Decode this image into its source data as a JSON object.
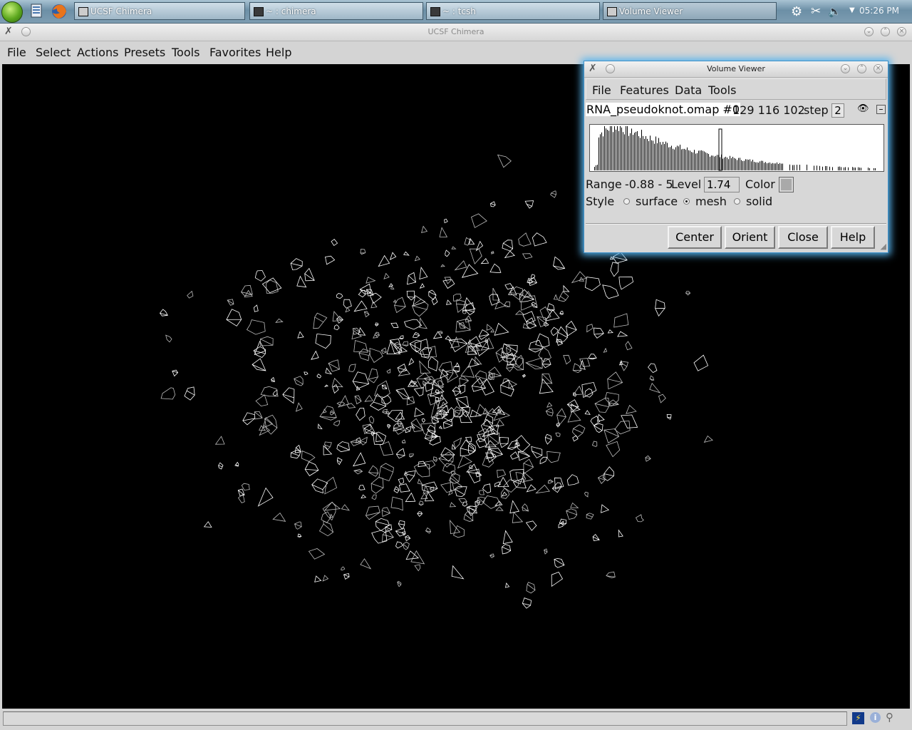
{
  "taskbar": {
    "tasks": [
      {
        "label": "UCSF Chimera"
      },
      {
        "label": "~ : chimera"
      },
      {
        "label": "~ : tcsh"
      },
      {
        "label": "Volume Viewer"
      }
    ],
    "clock": "05:26 PM"
  },
  "window": {
    "title": "UCSF Chimera",
    "menu": [
      "File",
      "Select",
      "Actions",
      "Presets",
      "Tools",
      "Favorites",
      "Help"
    ]
  },
  "volume_viewer": {
    "title": "Volume Viewer",
    "menu": [
      "File",
      "Features",
      "Data",
      "Tools"
    ],
    "map_name": "RNA_pseudoknot.omap #0",
    "dimensions": "129 116 102",
    "step_label": "step",
    "step_value": "2",
    "range_label": "Range",
    "range_value": "-0.88 - 5",
    "level_label": "Level",
    "level_value": "1.74",
    "color_label": "Color",
    "style_label": "Style",
    "styles": [
      {
        "label": "surface",
        "selected": false
      },
      {
        "label": "mesh",
        "selected": true
      },
      {
        "label": "solid",
        "selected": false
      }
    ],
    "buttons": [
      "Center",
      "Orient",
      "Close",
      "Help"
    ]
  }
}
